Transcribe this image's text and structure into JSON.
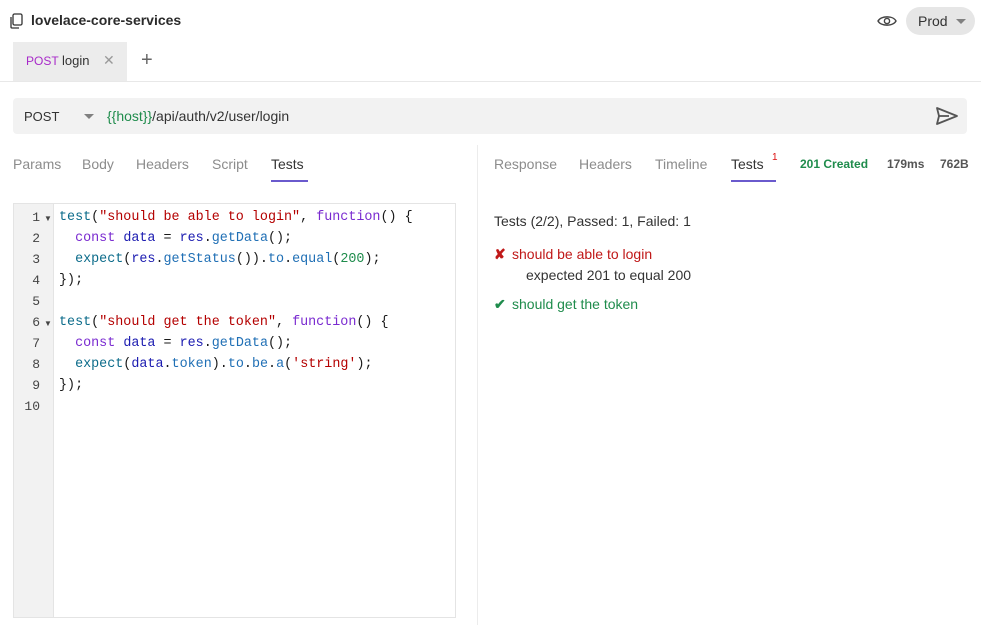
{
  "header": {
    "collection_name": "lovelace-core-services",
    "environment": "Prod"
  },
  "tabs": [
    {
      "method": "POST",
      "name": "login"
    }
  ],
  "request": {
    "method": "POST",
    "url_var": "{{host}}",
    "url_path": "/api/auth/v2/user/login"
  },
  "request_tabs": [
    "Params",
    "Body",
    "Headers",
    "Script",
    "Tests"
  ],
  "editor": {
    "line_numbers": [
      "1",
      "2",
      "3",
      "4",
      "5",
      "6",
      "7",
      "8",
      "9",
      "10"
    ]
  },
  "response_tabs": [
    "Response",
    "Headers",
    "Timeline",
    "Tests"
  ],
  "response_tests_badge": "1",
  "status": {
    "code": "201 Created",
    "time": "179ms",
    "size": "762B"
  },
  "results": {
    "summary": "Tests (2/2), Passed: 1, Failed: 1",
    "items": [
      {
        "status": "fail",
        "mark": "✘",
        "name": "should be able to login",
        "detail": "expected 201 to equal 200"
      },
      {
        "status": "pass",
        "mark": "✔",
        "name": "should get the token"
      }
    ]
  },
  "colors": {
    "method_post": "#a82ac9",
    "accent_underline": "#6a5acd",
    "success": "#1f8c4c",
    "failure": "#c01818"
  },
  "icons": [
    "collection-icon",
    "eye-icon",
    "close-icon",
    "plus-icon",
    "send-icon",
    "fold-arrow-icon",
    "cross-icon",
    "check-icon"
  ]
}
